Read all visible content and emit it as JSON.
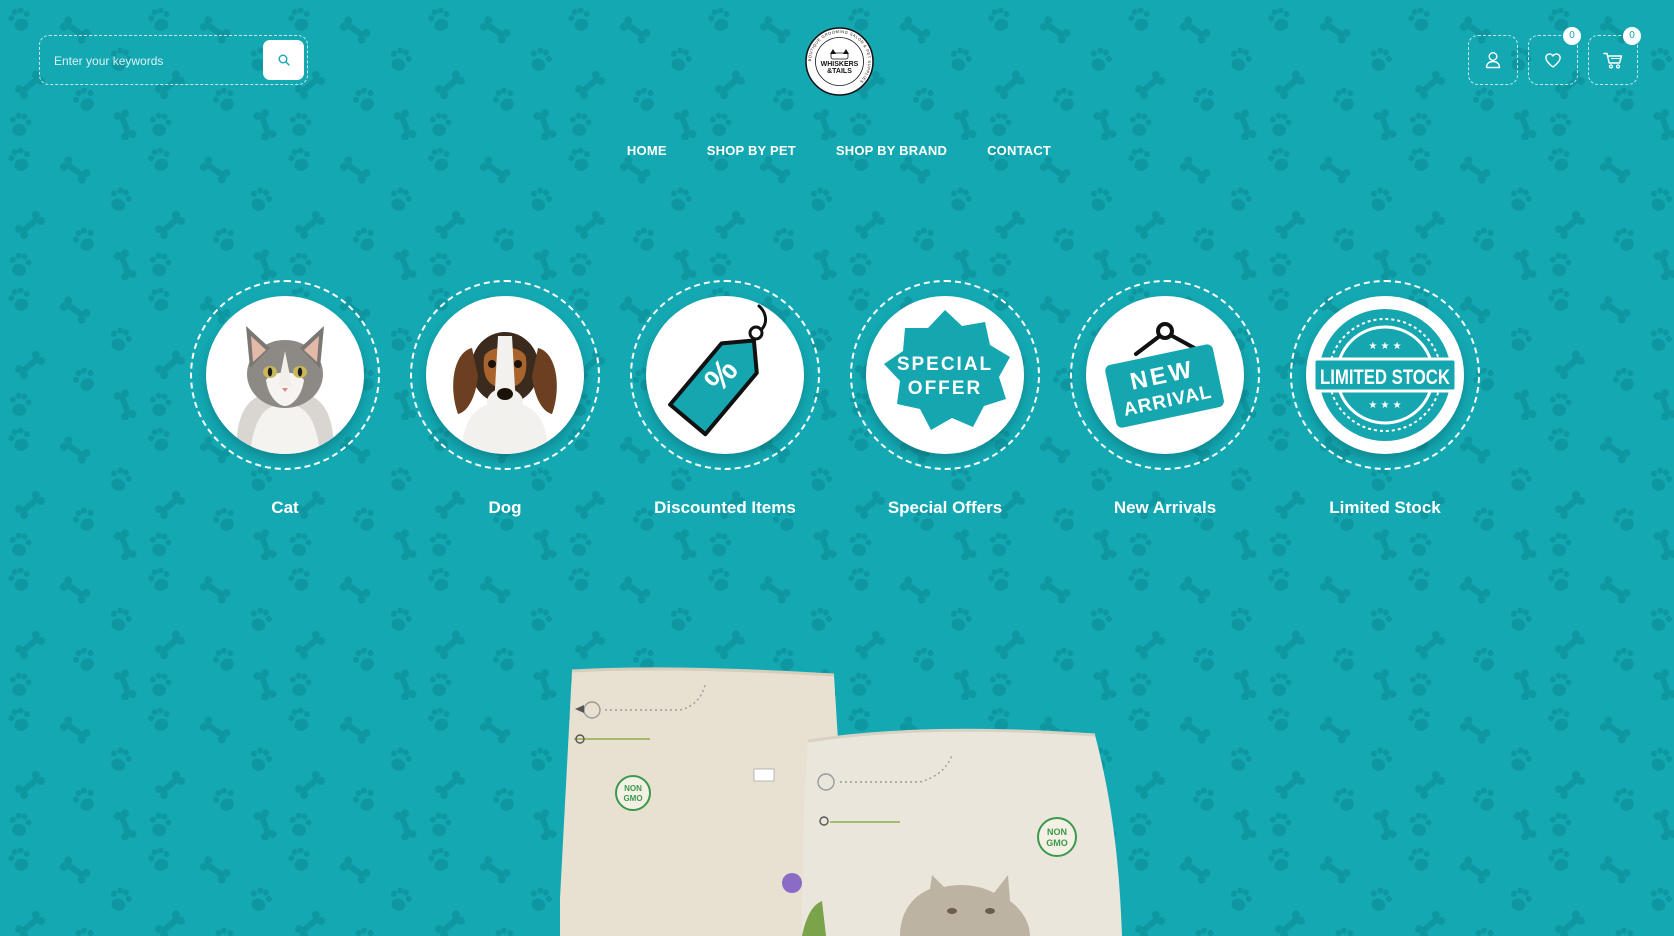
{
  "header": {
    "search": {
      "placeholder": "Enter your keywords",
      "button_icon": "search-icon"
    },
    "logo": {
      "line1": "WHISKERS",
      "line2": "&TAILS",
      "ring_text": "BOUTIQUE GROOMING SALON & PET SUPPLIES"
    },
    "icons": [
      {
        "name": "account-icon"
      },
      {
        "name": "heart-icon",
        "badge": "0"
      },
      {
        "name": "cart-icon",
        "badge": "0"
      }
    ]
  },
  "nav": {
    "items": [
      {
        "label": "HOME"
      },
      {
        "label": "SHOP BY PET"
      },
      {
        "label": "SHOP BY BRAND"
      },
      {
        "label": "CONTACT"
      }
    ]
  },
  "categories": [
    {
      "label": "Cat",
      "image": "cat-photo"
    },
    {
      "label": "Dog",
      "image": "dog-photo"
    },
    {
      "label": "Discounted Items",
      "image": "percent-tag-icon",
      "icon_text": "%"
    },
    {
      "label": "Special Offers",
      "image": "special-offer-badge",
      "icon_text": [
        "SPECIAL",
        "OFFER"
      ]
    },
    {
      "label": "New Arrivals",
      "image": "new-arrival-sign",
      "icon_text": [
        "NEW",
        "ARRIVAL"
      ]
    },
    {
      "label": "Limited Stock",
      "image": "limited-stock-stamp",
      "icon_text": "LIMITED STOCK"
    }
  ],
  "banner": {
    "product_image": "pet-food-bags",
    "bag_label": [
      "NON",
      "GMO"
    ]
  },
  "colors": {
    "background": "#13a8b2",
    "pattern": "#0f97a1",
    "accent": "#16a6b0",
    "white": "#ffffff",
    "bag": "#e9e2d4",
    "stamp_green": "#3a9a4a"
  }
}
